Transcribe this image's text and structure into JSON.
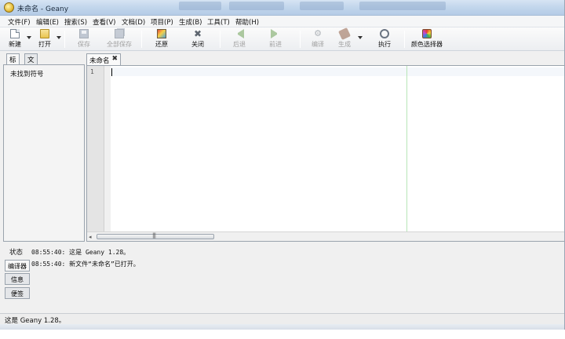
{
  "window": {
    "title": "未命名 - Geany"
  },
  "menu": [
    "文件(F)",
    "编辑(E)",
    "搜索(S)",
    "查看(V)",
    "文档(D)",
    "项目(P)",
    "生成(B)",
    "工具(T)",
    "帮助(H)"
  ],
  "toolbar": {
    "new": "新建",
    "open": "打开",
    "save": "保存",
    "save_all": "全部保存",
    "revert": "还原",
    "close": "关闭",
    "back": "后退",
    "forward": "前进",
    "compile": "编译",
    "build": "生成",
    "execute": "执行",
    "color_chooser": "颜色选择器"
  },
  "sidebar": {
    "tabs": [
      "标记",
      "文档"
    ],
    "empty_message": "未找到符号"
  },
  "editor": {
    "document_tab": "未命名",
    "line_number": "1",
    "scroll_grip": "|||"
  },
  "messages": {
    "tabs": [
      "状态",
      "编译器",
      "信息",
      "便签"
    ],
    "lines": [
      "08:55:40: 这是 Geany 1.28。",
      "08:55:40: 新文件“未命名”已打开。"
    ]
  },
  "statusbar": {
    "text": "这是 Geany 1.28。"
  }
}
